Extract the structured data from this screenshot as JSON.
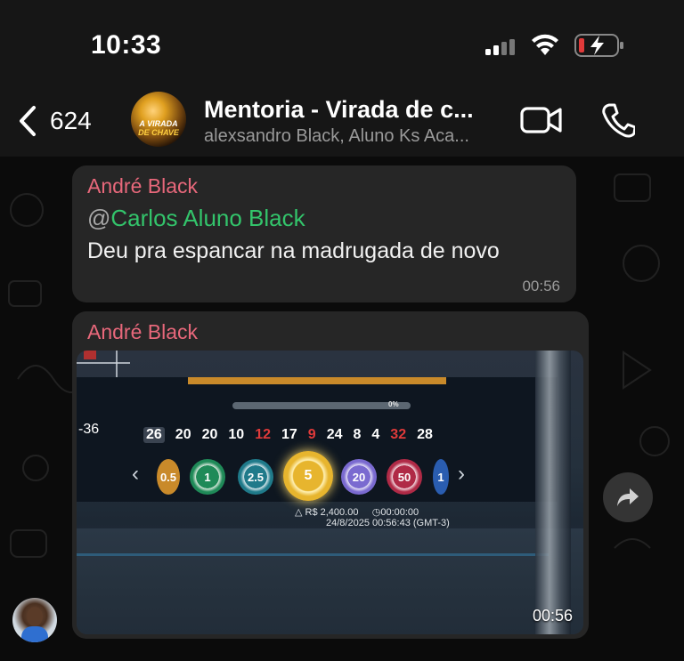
{
  "status_bar": {
    "time": "10:33"
  },
  "header": {
    "back_count": "624",
    "group_logo_line1": "A VIRADA",
    "group_logo_line2": "DE CHAVE",
    "title": "Mentoria - Virada de c...",
    "subtitle": "alexsandro Black, Aluno Ks Aca..."
  },
  "messages": [
    {
      "sender": "André Black",
      "mention_prefix": "@",
      "mention_name": "Carlos Aluno Black",
      "text": "Deu pra espancar na madrugada de novo",
      "time": "00:56"
    },
    {
      "sender": "André Black",
      "time": "00:56",
      "media": {
        "left_number": "-36",
        "progress_label": "0%",
        "recent_numbers": [
          {
            "n": "26",
            "color": "white"
          },
          {
            "n": "20",
            "color": "white"
          },
          {
            "n": "20",
            "color": "white"
          },
          {
            "n": "10",
            "color": "white"
          },
          {
            "n": "12",
            "color": "red"
          },
          {
            "n": "17",
            "color": "white"
          },
          {
            "n": "9",
            "color": "red"
          },
          {
            "n": "24",
            "color": "white"
          },
          {
            "n": "8",
            "color": "white"
          },
          {
            "n": "4",
            "color": "white"
          },
          {
            "n": "32",
            "color": "red"
          },
          {
            "n": "28",
            "color": "white"
          }
        ],
        "chips": [
          "0.5",
          "1",
          "2.5",
          "5",
          "20",
          "50",
          "1"
        ],
        "balance": "R$ 2,400.00",
        "timer": "00:00:00",
        "datetime": "24/8/2025 00:56:43 (GMT-3)"
      }
    }
  ],
  "colors": {
    "sender": "#e8687b",
    "mention": "#33c46b",
    "bubble": "#262626",
    "header_bg": "#161616"
  },
  "icons": {
    "back": "chevron-left-icon",
    "video": "video-camera-icon",
    "call": "phone-icon",
    "forward": "forward-arrow-icon"
  }
}
